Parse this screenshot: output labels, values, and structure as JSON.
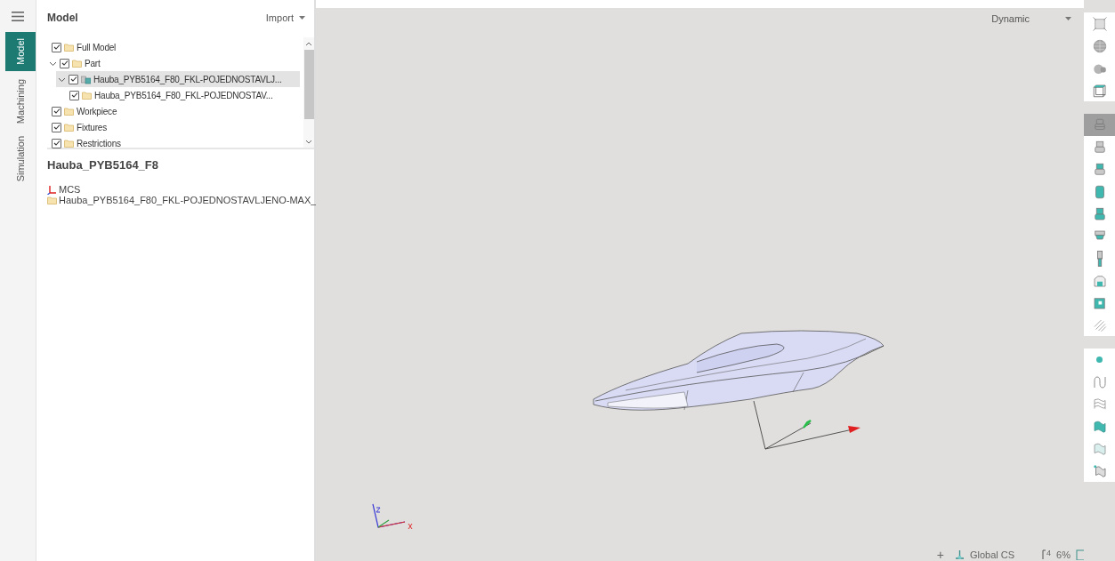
{
  "sidebar_tabs": [
    {
      "label": "Model",
      "selected": true
    },
    {
      "label": "Machining",
      "selected": false
    },
    {
      "label": "Simulation",
      "selected": false
    }
  ],
  "panel": {
    "title": "Model",
    "import_button": "Import"
  },
  "tree": [
    {
      "label": "Full Model",
      "kind": "folder",
      "checked": true,
      "selected": false
    },
    {
      "label": "Part",
      "kind": "folder",
      "checked": true,
      "selected": false,
      "expanded": true,
      "children": [
        {
          "label": "Hauba_PYB5164_F80_FKL-POJEDNOSTAVLJ...",
          "kind": "part",
          "checked": true,
          "selected": true,
          "expanded": true,
          "children": [
            {
              "label": "Hauba_PYB5164_F80_FKL-POJEDNOSTAV...",
              "kind": "folder",
              "checked": true,
              "selected": false
            }
          ]
        }
      ]
    },
    {
      "label": "Workpiece",
      "kind": "folder",
      "checked": true,
      "selected": false
    },
    {
      "label": "Fixtures",
      "kind": "folder",
      "checked": true,
      "selected": false
    },
    {
      "label": "Restrictions",
      "kind": "folder",
      "checked": true,
      "selected": false
    }
  ],
  "details": {
    "title": "Hauba_PYB5164_F8",
    "items": [
      {
        "kind": "mcs",
        "label": "MCS"
      },
      {
        "kind": "folder",
        "label": "Hauba_PYB5164_F80_FKL-POJEDNOSTAVLJENO-MAX_"
      }
    ]
  },
  "viewport": {
    "view_mode": "Dynamic"
  },
  "toolbar": {
    "groups": [
      [
        {
          "selected": false
        },
        {
          "selected": false
        },
        {
          "selected": false
        },
        {
          "selected": false
        }
      ],
      [
        {
          "selected": true
        },
        {
          "selected": false
        },
        {
          "selected": false
        },
        {
          "selected": false
        },
        {
          "selected": false
        },
        {
          "selected": false
        },
        {
          "selected": false
        },
        {
          "selected": false
        },
        {
          "selected": false
        },
        {
          "selected": false
        }
      ],
      [
        {
          "selected": false
        },
        {
          "selected": false
        },
        {
          "selected": false
        },
        {
          "selected": false
        },
        {
          "selected": false
        },
        {
          "selected": false
        }
      ]
    ]
  },
  "status_bar": {
    "add": "+",
    "cs_label": "Global CS",
    "zoom_count": "4",
    "zoom": "6%"
  }
}
